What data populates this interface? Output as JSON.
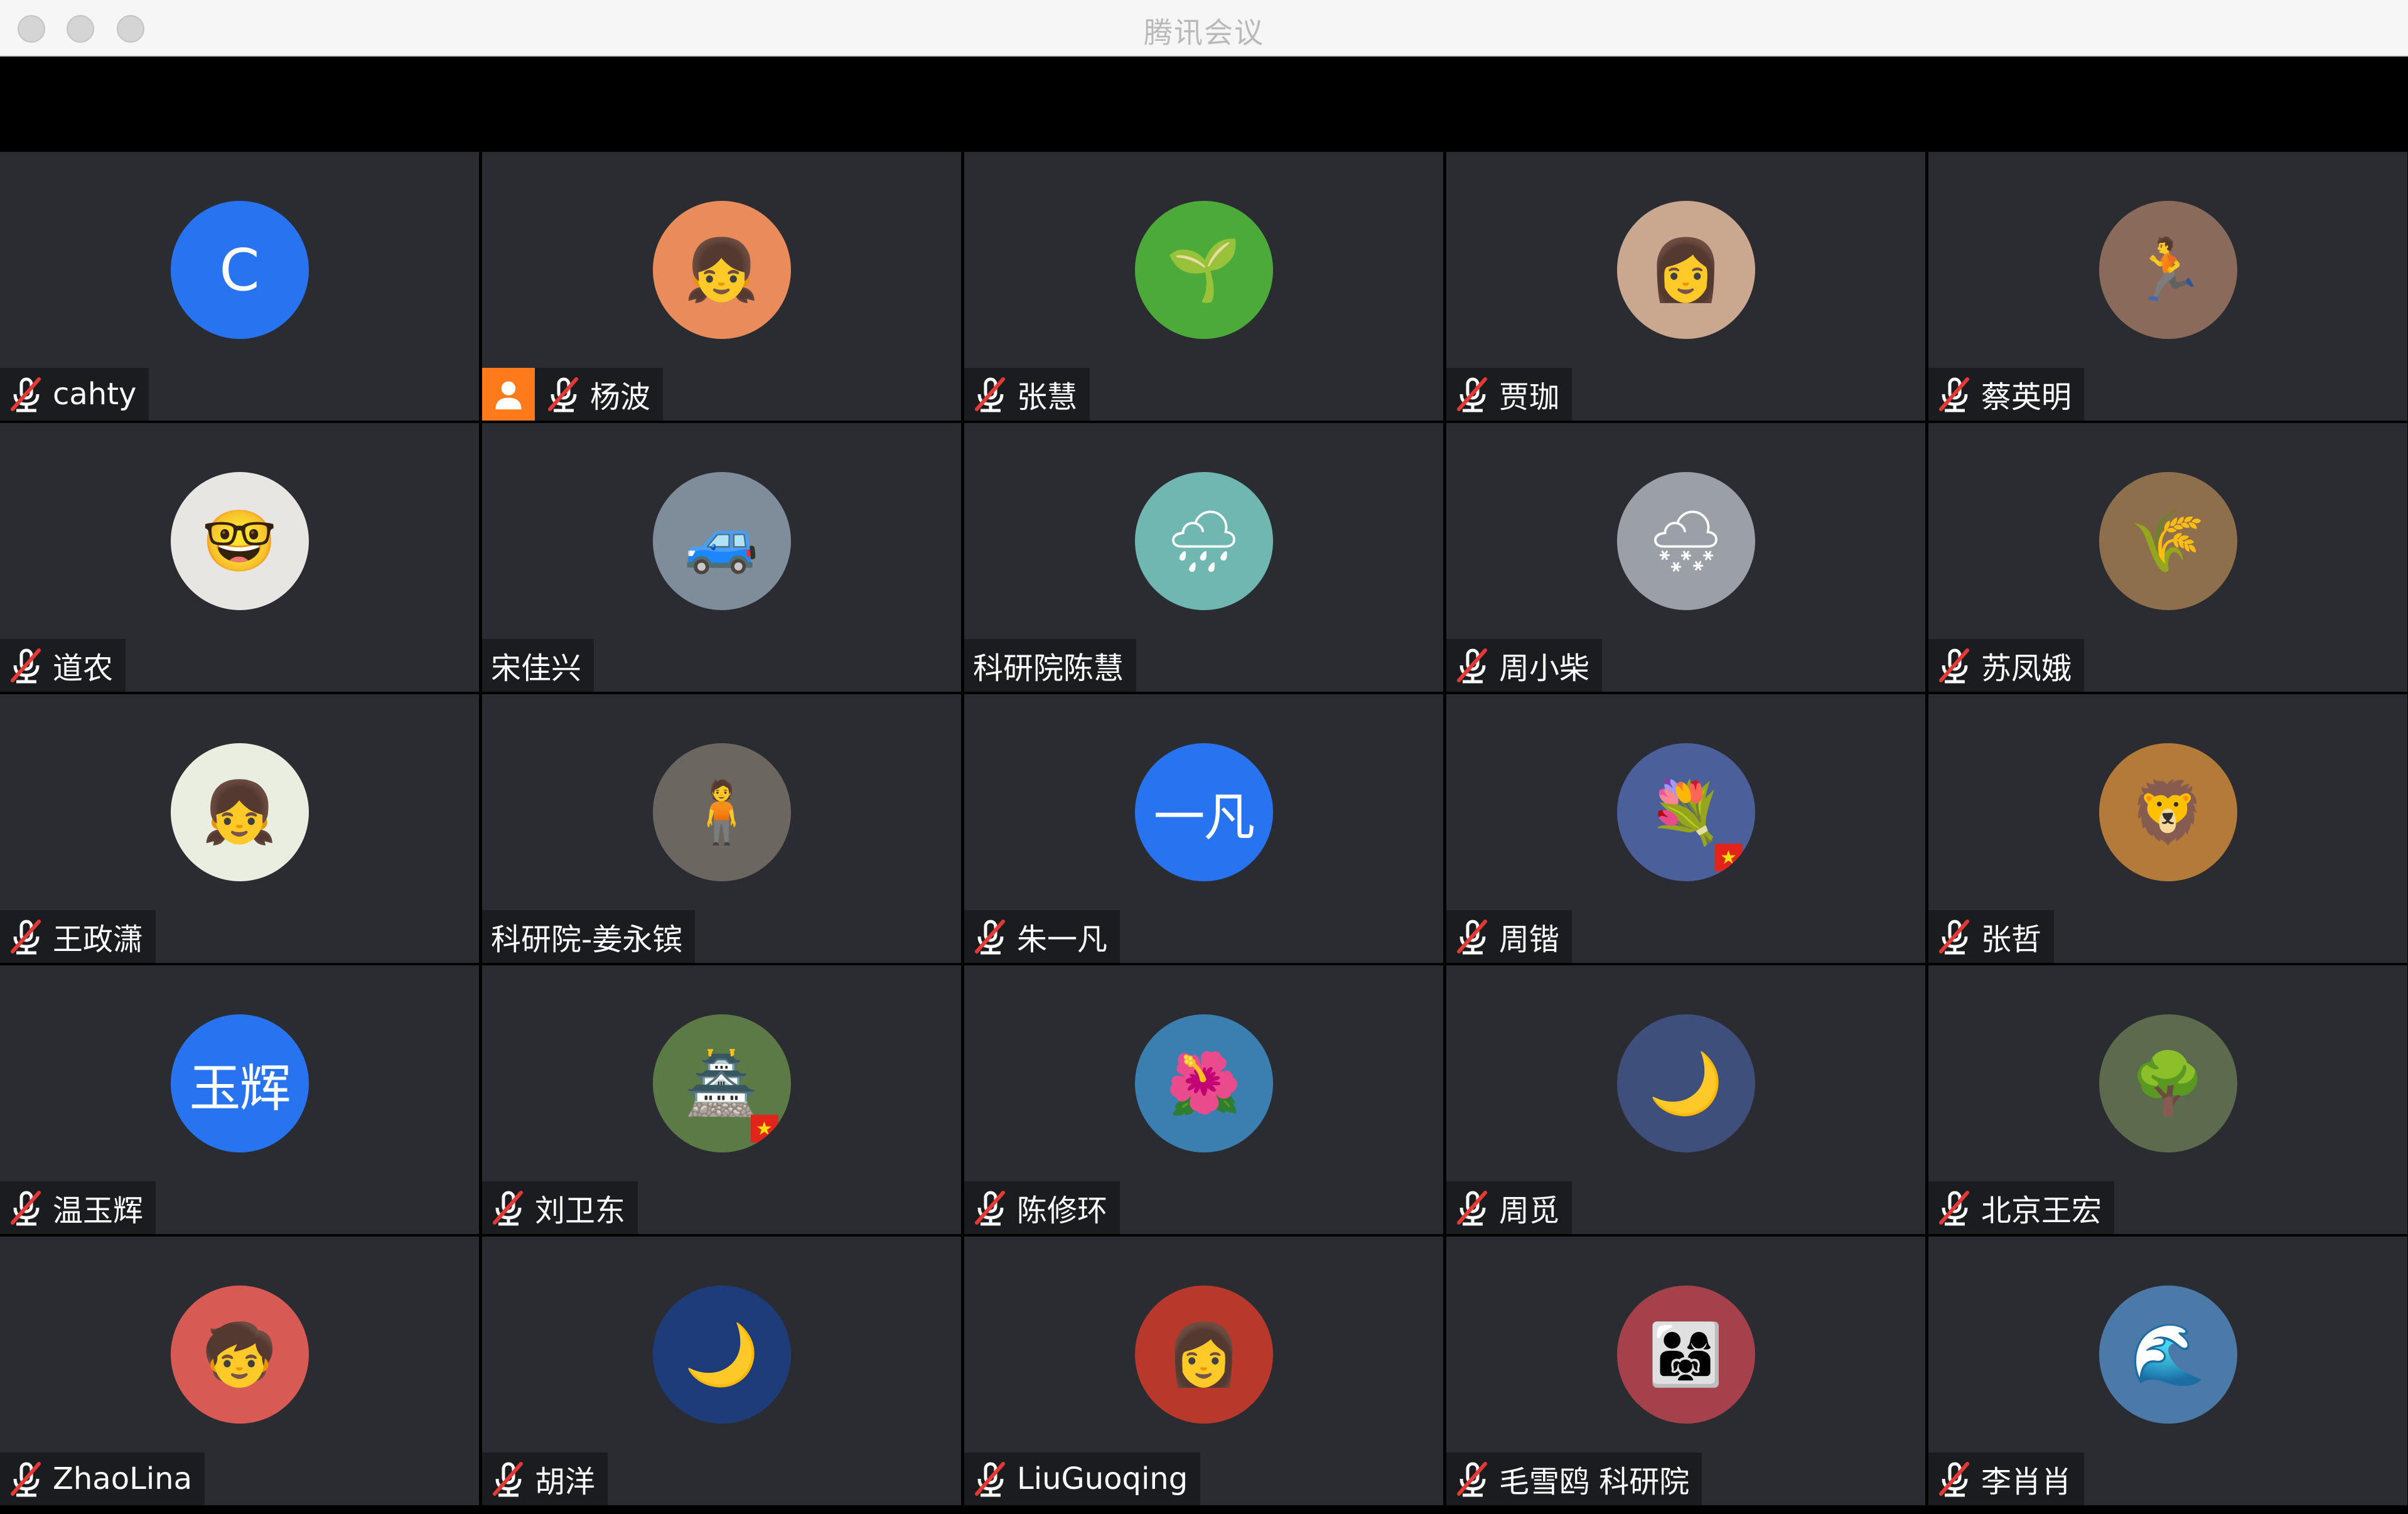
{
  "window": {
    "title": "腾讯会议"
  },
  "colors": {
    "tile_bg": "#2a2c31",
    "namebar_bg": "#1b1c1f",
    "avatar_blue": "#2873f0",
    "mute_red": "#e53935",
    "cam_orange": "#ff7a1a"
  },
  "participants": [
    {
      "name": "cahty",
      "muted": true,
      "avatar_type": "letter",
      "avatar_text": "C",
      "avatar_bg": "#2873f0"
    },
    {
      "name": "杨波",
      "muted": true,
      "camera_icon": true,
      "avatar_type": "image",
      "avatar_icon": "cartoon-girl-icon",
      "avatar_glyph": "👧",
      "avatar_bg": "#e98b5a"
    },
    {
      "name": "张慧",
      "muted": true,
      "avatar_type": "image",
      "avatar_icon": "sprout-icon",
      "avatar_glyph": "🌱",
      "avatar_bg": "#4caa3b"
    },
    {
      "name": "贾珈",
      "muted": true,
      "avatar_type": "image",
      "avatar_icon": "woman-portrait-icon",
      "avatar_glyph": "👩",
      "avatar_bg": "#caa890"
    },
    {
      "name": "蔡英明",
      "muted": true,
      "avatar_type": "image",
      "avatar_icon": "runner-icon",
      "avatar_glyph": "🏃",
      "avatar_bg": "#8a6a5b"
    },
    {
      "name": "道农",
      "muted": true,
      "avatar_type": "image",
      "avatar_icon": "cartoon-glasses-man-icon",
      "avatar_glyph": "🤓",
      "avatar_bg": "#e8e6e2"
    },
    {
      "name": "宋佳兴",
      "muted": false,
      "avatar_type": "image",
      "avatar_icon": "white-suv-icon",
      "avatar_glyph": "🚙",
      "avatar_bg": "#7f8c99"
    },
    {
      "name": "科研院陈慧",
      "muted": false,
      "avatar_type": "image",
      "avatar_icon": "rain-green-icon",
      "avatar_glyph": "🌧",
      "avatar_bg": "#6fb7b0"
    },
    {
      "name": "周小柴",
      "muted": true,
      "avatar_type": "image",
      "avatar_icon": "snow-trees-icon",
      "avatar_glyph": "🌨",
      "avatar_bg": "#9aa0a6"
    },
    {
      "name": "苏凤娥",
      "muted": true,
      "avatar_type": "image",
      "avatar_icon": "dried-grass-icon",
      "avatar_glyph": "🌾",
      "avatar_bg": "#8d6f4c"
    },
    {
      "name": "王政潇",
      "muted": true,
      "avatar_type": "image",
      "avatar_icon": "flower-crown-girl-icon",
      "avatar_glyph": "👧",
      "avatar_bg": "#e9eee0"
    },
    {
      "name": "科研院-姜永镔",
      "muted": false,
      "avatar_type": "image",
      "avatar_icon": "man-standing-icon",
      "avatar_glyph": "🧍",
      "avatar_bg": "#6b6660"
    },
    {
      "name": "朱一凡",
      "muted": true,
      "avatar_type": "letter2",
      "avatar_text": "一凡",
      "avatar_bg": "#2873f0"
    },
    {
      "name": "周锴",
      "muted": true,
      "avatar_type": "image",
      "avatar_icon": "hydrangea-icon",
      "avatar_glyph": "💐",
      "avatar_bg": "#4b5f9a",
      "flag": true
    },
    {
      "name": "张哲",
      "muted": true,
      "avatar_type": "image",
      "avatar_icon": "lion-cubs-icon",
      "avatar_glyph": "🦁",
      "avatar_bg": "#b47a3a"
    },
    {
      "name": "温玉辉",
      "muted": true,
      "avatar_type": "letter2",
      "avatar_text": "玉辉",
      "avatar_bg": "#2873f0"
    },
    {
      "name": "刘卫东",
      "muted": true,
      "avatar_type": "image",
      "avatar_icon": "pavilion-icon",
      "avatar_glyph": "🏯",
      "avatar_bg": "#5b7a45",
      "flag": true
    },
    {
      "name": "陈修环",
      "muted": true,
      "avatar_type": "image",
      "avatar_icon": "protea-flower-icon",
      "avatar_glyph": "🌺",
      "avatar_bg": "#3a7fb0"
    },
    {
      "name": "周觅",
      "muted": true,
      "avatar_type": "image",
      "avatar_icon": "night-girl-icon",
      "avatar_glyph": "🌙",
      "avatar_bg": "#3d4f7a"
    },
    {
      "name": "北京王宏",
      "muted": true,
      "avatar_type": "image",
      "avatar_icon": "willow-garden-icon",
      "avatar_glyph": "🌳",
      "avatar_bg": "#5c6a4e"
    },
    {
      "name": "ZhaoLina",
      "muted": true,
      "avatar_type": "image",
      "avatar_icon": "cartoon-kid-icon",
      "avatar_glyph": "🧒",
      "avatar_bg": "#d85a55"
    },
    {
      "name": "胡洋",
      "muted": true,
      "avatar_type": "image",
      "avatar_icon": "moon-night-icon",
      "avatar_glyph": "🌙",
      "avatar_bg": "#1f3c7a"
    },
    {
      "name": "LiuGuoqing",
      "muted": true,
      "avatar_type": "image",
      "avatar_icon": "sketch-woman-icon",
      "avatar_glyph": "👩",
      "avatar_bg": "#b8392c"
    },
    {
      "name": "毛雪鸥 科研院",
      "muted": true,
      "avatar_type": "image",
      "avatar_icon": "family-photo-icon",
      "avatar_glyph": "👨‍👩‍👧",
      "avatar_bg": "#a5414a"
    },
    {
      "name": "李肖肖",
      "muted": true,
      "avatar_type": "image",
      "avatar_icon": "lake-girl-icon",
      "avatar_glyph": "🌊",
      "avatar_bg": "#4b79a8"
    }
  ]
}
